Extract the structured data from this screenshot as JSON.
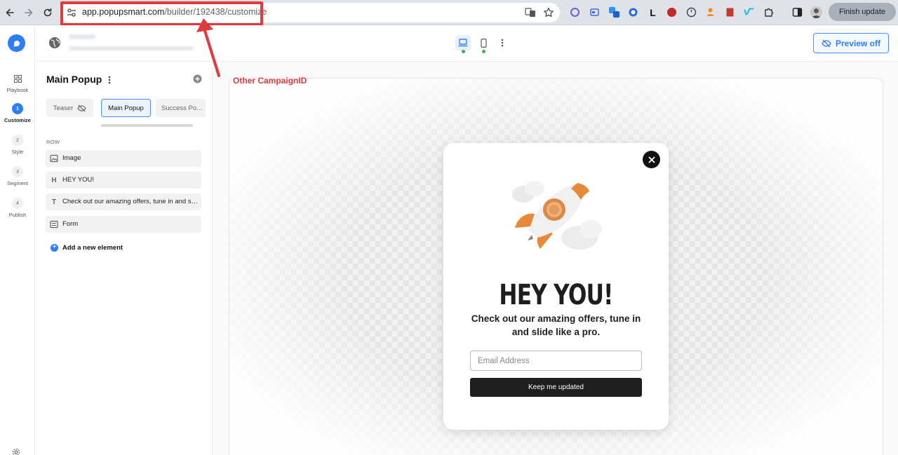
{
  "browser": {
    "url_host": "app.popupsmart.com",
    "url_path": "/builder/192438/customize",
    "finish_update_label": "Finish update",
    "ext_l_label": "L"
  },
  "rail": {
    "items": [
      {
        "label": "Playbook",
        "number": ""
      },
      {
        "label": "Customize",
        "number": "1"
      },
      {
        "label": "Style",
        "number": "2"
      },
      {
        "label": "Segment",
        "number": "3"
      },
      {
        "label": "Publish",
        "number": "4"
      }
    ]
  },
  "header": {
    "preview_label": "Preview off"
  },
  "panel": {
    "title": "Main Popup",
    "tabs": [
      {
        "label": "Teaser"
      },
      {
        "label": "Main Popup"
      },
      {
        "label": "Success Po..."
      }
    ],
    "section_label": "ROW",
    "layers": [
      {
        "label": "Image",
        "icon": "image-icon",
        "glyph": ""
      },
      {
        "label": "HEY YOU!",
        "icon": "heading-icon",
        "glyph": "H"
      },
      {
        "label": "Check out our amazing offers, tune in and slide like a pro.",
        "icon": "text-icon",
        "glyph": "T"
      },
      {
        "label": "Form",
        "icon": "form-icon",
        "glyph": ""
      }
    ],
    "add_element_label": "Add a new element"
  },
  "canvas": {
    "annotation": "Other CampaignID",
    "popup": {
      "heading": "HEY YOU!",
      "text": "Check out our amazing offers, tune in and slide like a pro.",
      "email_placeholder": "Email Address",
      "button_label": "Keep me updated"
    }
  },
  "colors": {
    "accent": "#2d7ff9",
    "annotation_red": "#e03a3e",
    "popup_dark": "#1e1e1e",
    "active_dot": "#38b24a"
  }
}
